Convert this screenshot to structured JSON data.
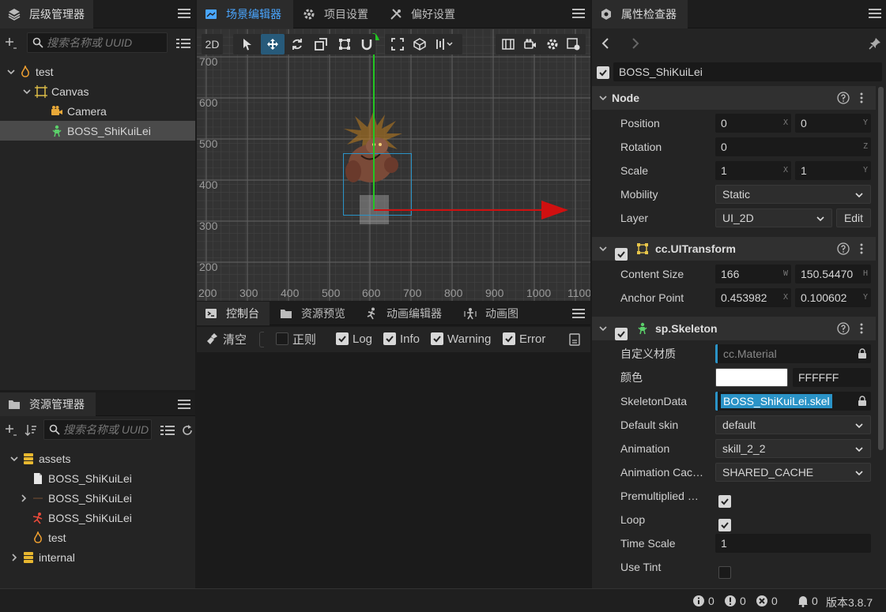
{
  "hierarchy": {
    "tab": "层级管理器",
    "search_placeholder": "搜索名称或 UUID",
    "nodes": [
      {
        "label": "test",
        "icon": "fire-icon"
      },
      {
        "label": "Canvas",
        "icon": "canvas-icon"
      },
      {
        "label": "Camera",
        "icon": "camera-icon"
      },
      {
        "label": "BOSS_ShiKuiLei",
        "icon": "skeleton-node-icon"
      }
    ]
  },
  "assets": {
    "tab": "资源管理器",
    "search_placeholder": "搜索名称或 UUID",
    "items": [
      {
        "label": "assets",
        "icon": "database-icon"
      },
      {
        "label": "BOSS_ShiKuiLei",
        "icon": "file-icon"
      },
      {
        "label": "BOSS_ShiKuiLei",
        "icon": "texture-icon"
      },
      {
        "label": "BOSS_ShiKuiLei",
        "icon": "skeleton-asset-icon"
      },
      {
        "label": "test",
        "icon": "fire-icon"
      },
      {
        "label": "internal",
        "icon": "database-icon"
      }
    ]
  },
  "scene": {
    "tabs": [
      "场景编辑器",
      "项目设置",
      "偏好设置"
    ],
    "mode_2d": "2D",
    "y_ticks": [
      "700",
      "600",
      "500",
      "400",
      "300",
      "200"
    ],
    "x_ticks": [
      "200",
      "300",
      "400",
      "500",
      "600",
      "700",
      "800",
      "900",
      "1000",
      "1100"
    ]
  },
  "console": {
    "tabs": [
      "控制台",
      "资源预览",
      "动画编辑器",
      "动画图"
    ],
    "clear": "清空",
    "filters": [
      {
        "label": "正则",
        "checked": false
      },
      {
        "label": "Log",
        "checked": true
      },
      {
        "label": "Info",
        "checked": true
      },
      {
        "label": "Warning",
        "checked": true
      },
      {
        "label": "Error",
        "checked": true
      }
    ]
  },
  "inspector": {
    "tab": "属性检查器",
    "node_name": "BOSS_ShiKuiLei",
    "node_section": "Node",
    "position": {
      "label": "Position",
      "x": "0",
      "y": "0"
    },
    "rotation": {
      "label": "Rotation",
      "z": "0"
    },
    "scale": {
      "label": "Scale",
      "x": "1",
      "y": "1"
    },
    "mobility": {
      "label": "Mobility",
      "value": "Static"
    },
    "layer": {
      "label": "Layer",
      "value": "UI_2D",
      "edit": "Edit"
    },
    "uitransform": {
      "title": "cc.UITransform",
      "content_size": {
        "label": "Content Size",
        "w": "166",
        "h": "150.54470"
      },
      "anchor_point": {
        "label": "Anchor Point",
        "x": "0.453982",
        "y": "0.100602"
      }
    },
    "skeleton": {
      "title": "sp.Skeleton",
      "custom_material": {
        "label": "自定义材质",
        "value": "cc.Material"
      },
      "color": {
        "label": "颜色",
        "hex": "FFFFFF",
        "swatch": "#ffffff"
      },
      "skeleton_data": {
        "label": "SkeletonData",
        "value": "BOSS_ShiKuiLei.skel"
      },
      "default_skin": {
        "label": "Default skin",
        "value": "default"
      },
      "animation": {
        "label": "Animation",
        "value": "skill_2_2"
      },
      "animation_cache": {
        "label": "Animation Cac…",
        "value": "SHARED_CACHE"
      },
      "premultiplied": {
        "label": "Premultiplied …",
        "checked": true
      },
      "loop": {
        "label": "Loop",
        "checked": true
      },
      "time_scale": {
        "label": "Time Scale",
        "value": "1"
      },
      "use_tint": {
        "label": "Use Tint",
        "checked": false
      }
    }
  },
  "status": {
    "info_count": "0",
    "warn_count": "0",
    "error_count": "0",
    "notify_count": "0",
    "version": "版本3.8.7"
  },
  "colors": {
    "accent_blue": "#4aa6ff",
    "selection_fill": "#2a93c7",
    "gizmo_green": "#22c722",
    "gizmo_red": "#d01010"
  }
}
